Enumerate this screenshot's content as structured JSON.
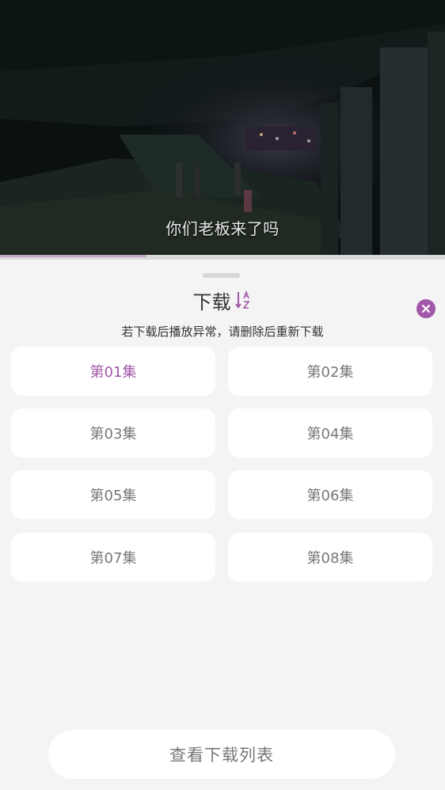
{
  "video": {
    "subtitle": "你们老板来了吗",
    "progress": 0.33
  },
  "sheet": {
    "title": "下载",
    "sort_icon": "sort-az-icon",
    "close_icon": "close-icon",
    "notice": "若下载后播放异常，请删除后重新下载",
    "episodes": [
      {
        "label": "第01集",
        "selected": true
      },
      {
        "label": "第02集",
        "selected": false
      },
      {
        "label": "第03集",
        "selected": false
      },
      {
        "label": "第04集",
        "selected": false
      },
      {
        "label": "第05集",
        "selected": false
      },
      {
        "label": "第06集",
        "selected": false
      },
      {
        "label": "第07集",
        "selected": false
      },
      {
        "label": "第08集",
        "selected": false
      }
    ],
    "download_list_button": "查看下载列表"
  },
  "colors": {
    "accent": "#a158a8",
    "progress": "#c7a5c8",
    "sheet_bg": "#f4f4f4"
  }
}
